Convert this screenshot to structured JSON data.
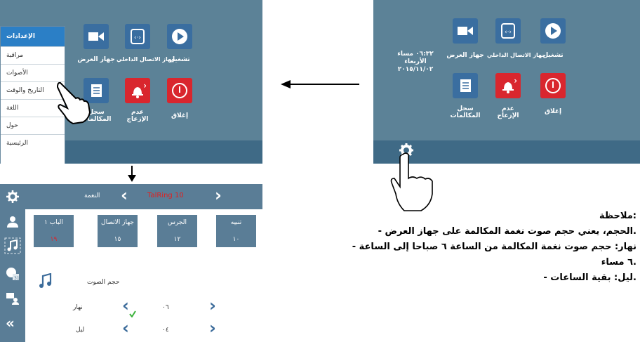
{
  "settings_screen": {
    "apps": {
      "display_device": "جهاز العرض",
      "intercom": "جهاز الاتصال الداخلي",
      "play": "تشغيل",
      "call_log": [
        "سجل",
        "المكالمات"
      ],
      "dnd": [
        "عدم",
        "الإزعاج"
      ],
      "shutdown": "إغلاق"
    },
    "menu": [
      "الإعدادات",
      "مراقبة",
      "الأصوات",
      "التاريخ والوقت",
      "اللغة",
      "حول",
      "الرئيسية"
    ]
  },
  "home_screen": {
    "time": "٠٦:٣٢ مساء",
    "day": "الأربعاء",
    "date": "٢٠١٥/١١/٠٢",
    "apps": {
      "display_device": "جهاز العرض",
      "intercom": "جهاز الاتصال الداخلي",
      "play": "تشغيل",
      "call_log": [
        "سجل",
        "المكالمات"
      ],
      "dnd": [
        "عدم",
        "الإزعاج"
      ],
      "shutdown": "إغلاق"
    }
  },
  "sound_screen": {
    "ringtone_label": "النغمة",
    "ringtone_value": "TalRing 10",
    "cards": [
      {
        "title": "الباب ١",
        "value": "١٩"
      },
      {
        "title": "جهاز الاتصال",
        "value": "١٥"
      },
      {
        "title": "الجرس",
        "value": "١٢"
      },
      {
        "title": "تنبيه",
        "value": "١٠"
      }
    ],
    "volume_label": "حجم الصوت",
    "day_label": "نهار",
    "day_value": "٠٦",
    "night_label": "ليل",
    "night_value": "٠٤"
  },
  "note": {
    "heading": "ملاحظة:",
    "line1": "- الحجم، يعني حجم صوت نغمة المكالمة على جهاز العرض.",
    "line2": "- نهار: حجم صوت نغمة المكالمة من الساعة ٦ صباحا إلى الساعة",
    "line3": "٦ مساء.",
    "line4": "- ليل: بقية الساعات."
  },
  "colors": {
    "accent_blue": "#3a6ea0",
    "accent_red": "#d9262e",
    "screen_bg": "#5c8297",
    "ringtone_red": "#e02020",
    "value_red": "#d9262e",
    "check_green": "#3cb33c"
  }
}
